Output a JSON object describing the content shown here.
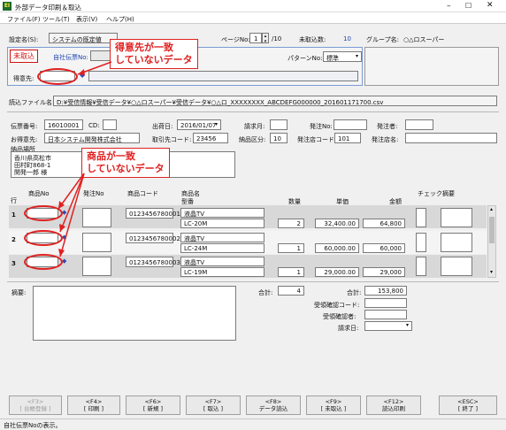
{
  "window": {
    "title": "外部データ印刷＆取込",
    "app_icon": "EI"
  },
  "menu": [
    "ファイル(F)",
    "ツール(T)",
    "表示(V)",
    "ヘルプ(H)"
  ],
  "top": {
    "settings_label": "設定名(S):",
    "settings_value": "システムの既定値",
    "page_label": "ページNo:",
    "page_value": "1",
    "page_total": "/10",
    "unimported_label": "未取込数:",
    "unimported_value": "10",
    "group_label": "グループ名:",
    "group_value": "○△ロスーパー"
  },
  "status_panel": {
    "badge": "未取込",
    "own_slip_label": "自社伝票No:",
    "pattern_label": "パターンNo:",
    "pattern_value": "標準",
    "customer_label": "得意先:"
  },
  "file": {
    "label": "読込ファイル名:",
    "path": "D:¥受信情報¥受信データ¥○△ロスーパー¥受信データ¥○△ロ_XXXXXXXX_ABCDEFG000000_201601171700.csv"
  },
  "header_fields": {
    "slip_no_label": "伝票番号:",
    "slip_no": "16010001",
    "cd_label": "CD:",
    "ship_date_label": "出荷日:",
    "ship_date": "2016/01/07",
    "invoice_month_label": "請求月:",
    "order_no_label": "発注No:",
    "orderer_label": "発注者:",
    "customer_label": "お得意先:",
    "customer": "日本システム開発株式会社",
    "supplier_code_label": "取引先コード:",
    "supplier_code": "23456",
    "delivery_class_label": "納品区分:",
    "delivery_class": "10",
    "store_code_label": "発注店コード:",
    "store_code": "101",
    "store_name_label": "発注店名:",
    "delivery_addr_label": "納品場所",
    "delivery_addr_lines": [
      "香川県高松市",
      "田村町868-1",
      "関発一郎 様"
    ]
  },
  "columns": {
    "row": "行",
    "item_no": "商品No",
    "order_no": "発注No",
    "item_code": "商品コード",
    "item_name": "商品名",
    "model": "型番",
    "qty": "数量",
    "price": "単価",
    "amount": "金額",
    "check": "チェック",
    "note": "摘要"
  },
  "rows": [
    {
      "no": "1",
      "code": "0123456780001",
      "name": "液晶TV",
      "model": "LC-20M",
      "qty": "2",
      "price": "32,400.00",
      "amount": "64,800"
    },
    {
      "no": "2",
      "code": "0123456780002",
      "name": "液晶TV",
      "model": "LC-24M",
      "qty": "1",
      "price": "60,000.00",
      "amount": "60,000"
    },
    {
      "no": "3",
      "code": "0123456780003",
      "name": "液晶TV",
      "model": "LC-19M",
      "qty": "1",
      "price": "29,000.00",
      "amount": "29,000"
    }
  ],
  "footer": {
    "note_label": "摘要:",
    "total_label": "合計:",
    "total_qty": "4",
    "total_label2": "合計:",
    "total_amount": "153,800",
    "confirm_code_label": "受領確認コード:",
    "confirmer_label": "受領確認者:",
    "invoice_date_label": "請求日:"
  },
  "fkeys": [
    {
      "key": "<F3>",
      "label": "[ 台帳登録 ]",
      "enabled": false
    },
    {
      "key": "<F4>",
      "label": "[ 印刷 ]",
      "enabled": true
    },
    {
      "key": "<F6>",
      "label": "[ 新規 ]",
      "enabled": true
    },
    {
      "key": "<F7>",
      "label": "[ 取込 ]",
      "enabled": true
    },
    {
      "key": "<F8>",
      "label": "データ読込",
      "enabled": true
    },
    {
      "key": "<F9>",
      "label": "[ 未取込 ]",
      "enabled": true
    },
    {
      "key": "<F12>",
      "label": "読込印刷",
      "enabled": true
    },
    {
      "key": "<ESC>",
      "label": "[ 終了 ]",
      "enabled": true
    }
  ],
  "statusbar": "自社伝票Noの表示。",
  "annotations": {
    "callout_customer": [
      "得意先が一致",
      "していないデータ"
    ],
    "callout_item": [
      "商品が一致",
      "していないデータ"
    ]
  },
  "colors": {
    "accent_red": "#e02020",
    "badge_red": "#d01010",
    "row_gray": "#d8d8d8"
  }
}
